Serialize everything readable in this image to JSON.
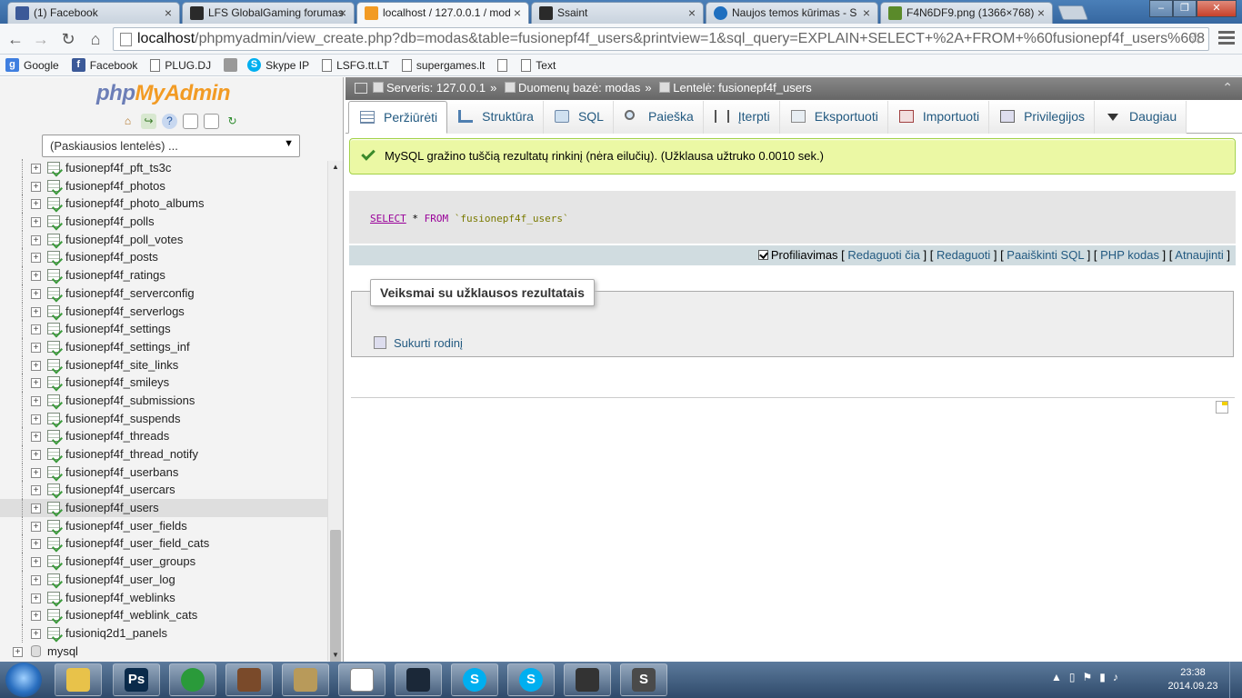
{
  "browser": {
    "tabs": [
      {
        "label": "(1) Facebook",
        "favicon": "facebook-icon",
        "color": "#3b5998"
      },
      {
        "label": "LFS GlobalGaming forumas",
        "favicon": "lfs-icon",
        "color": "#2a2a2a"
      },
      {
        "label": "localhost / 127.0.0.1 / mod",
        "favicon": "pma-icon",
        "color": "#f29b24"
      },
      {
        "label": "Ssaint",
        "favicon": "ssaint-icon",
        "color": "#2a2a2a"
      },
      {
        "label": "Naujos temos kūrimas - S",
        "favicon": "steam-icon",
        "color": "#1f6fbf"
      },
      {
        "label": "F4N6DF9.png (1366×768)",
        "favicon": "image-icon",
        "color": "#5a8a2a"
      }
    ],
    "url_host": "localhost",
    "url_path": "/phpmyadmin/view_create.php?db=modas&table=fusionepf4f_users&printview=1&sql_query=EXPLAIN+SELECT+%2A+FROM+%60fusionepf4f_users%608",
    "bookmarks": [
      {
        "label": "Google",
        "icon": "google-icon",
        "color": "#3f7fe0"
      },
      {
        "label": "Facebook",
        "icon": "facebook-icon",
        "color": "#3b5998"
      },
      {
        "label": "PLUG.DJ",
        "icon": "document-icon",
        "color": ""
      },
      {
        "label": "",
        "icon": "chat-icon",
        "color": "#999"
      },
      {
        "label": "Skype IP",
        "icon": "skype-icon",
        "color": "#00aff0"
      },
      {
        "label": "LSFG.tt.LT",
        "icon": "document-icon",
        "color": ""
      },
      {
        "label": "supergames.lt",
        "icon": "document-icon",
        "color": ""
      },
      {
        "label": "",
        "icon": "document-icon",
        "color": ""
      },
      {
        "label": "Text",
        "icon": "document-icon",
        "color": ""
      }
    ]
  },
  "sidebar": {
    "logo": {
      "php": "php",
      "my": "My",
      "admin": "Admin"
    },
    "recent_tables": "(Paskiausios lentelės) ...",
    "tables": [
      "fusionepf4f_pft_ts3c",
      "fusionepf4f_photos",
      "fusionepf4f_photo_albums",
      "fusionepf4f_polls",
      "fusionepf4f_poll_votes",
      "fusionepf4f_posts",
      "fusionepf4f_ratings",
      "fusionepf4f_serverconfig",
      "fusionepf4f_serverlogs",
      "fusionepf4f_settings",
      "fusionepf4f_settings_inf",
      "fusionepf4f_site_links",
      "fusionepf4f_smileys",
      "fusionepf4f_submissions",
      "fusionepf4f_suspends",
      "fusionepf4f_threads",
      "fusionepf4f_thread_notify",
      "fusionepf4f_userbans",
      "fusionepf4f_usercars",
      "fusionepf4f_users",
      "fusionepf4f_user_fields",
      "fusionepf4f_user_field_cats",
      "fusionepf4f_user_groups",
      "fusionepf4f_user_log",
      "fusionepf4f_weblinks",
      "fusionepf4f_weblink_cats",
      "fusioniq2d1_panels"
    ],
    "selected_table": "fusionepf4f_users",
    "databases": [
      "mysql"
    ]
  },
  "breadcrumb": {
    "server": "Serveris: 127.0.0.1",
    "database": "Duomenų bazė: modas",
    "table": "Lentelė: fusionepf4f_users"
  },
  "tabs": [
    {
      "label": "Peržiūrėti",
      "icon": "browse-icon",
      "active": true
    },
    {
      "label": "Struktūra",
      "icon": "structure-icon",
      "active": false
    },
    {
      "label": "SQL",
      "icon": "sql-icon",
      "active": false
    },
    {
      "label": "Paieška",
      "icon": "search-icon",
      "active": false
    },
    {
      "label": "Įterpti",
      "icon": "insert-icon",
      "active": false
    },
    {
      "label": "Eksportuoti",
      "icon": "export-icon",
      "active": false
    },
    {
      "label": "Importuoti",
      "icon": "import-icon",
      "active": false
    },
    {
      "label": "Privilegijos",
      "icon": "privileges-icon",
      "active": false
    },
    {
      "label": "Daugiau",
      "icon": "more-icon",
      "active": false
    }
  ],
  "message": "MySQL gražino tuščią rezultatų rinkinį (nėra eilučių). (Užklausa užtruko 0.0010 sek.)",
  "sql": {
    "select": "SELECT",
    "star": "*",
    "from": "FROM",
    "table": "`fusionepf4f_users`"
  },
  "sql_links": {
    "profiling": "Profiliavimas",
    "profiling_checked": true,
    "edit_inline": "Redaguoti čia",
    "edit": "Redaguoti",
    "explain": "Paaiškinti SQL",
    "php": "PHP kodas",
    "refresh": "Atnaujinti"
  },
  "operations": {
    "legend": "Veiksmai su užklausos rezultatais",
    "create_view": "Sukurti rodinį"
  },
  "taskbar": {
    "apps": [
      {
        "name": "explorer",
        "label": "",
        "color": "#e8c24a"
      },
      {
        "name": "photoshop",
        "label": "Ps",
        "color": "#0a2a4a"
      },
      {
        "name": "chrome",
        "label": "",
        "color": "#2a9a3a"
      },
      {
        "name": "game-avatar",
        "label": "",
        "color": "#7a4a2a"
      },
      {
        "name": "game-map",
        "label": "",
        "color": "#b89a5a"
      },
      {
        "name": "notepad",
        "label": "",
        "color": "#ffffff"
      },
      {
        "name": "steam",
        "label": "",
        "color": "#1b2838"
      },
      {
        "name": "skype-1",
        "label": "S",
        "color": "#00aff0"
      },
      {
        "name": "skype-2",
        "label": "S",
        "color": "#00aff0"
      },
      {
        "name": "lfs",
        "label": "",
        "color": "#333333"
      },
      {
        "name": "sublime",
        "label": "S",
        "color": "#4a4a4a"
      }
    ],
    "time": "23:38",
    "date": "2014.09.23"
  }
}
